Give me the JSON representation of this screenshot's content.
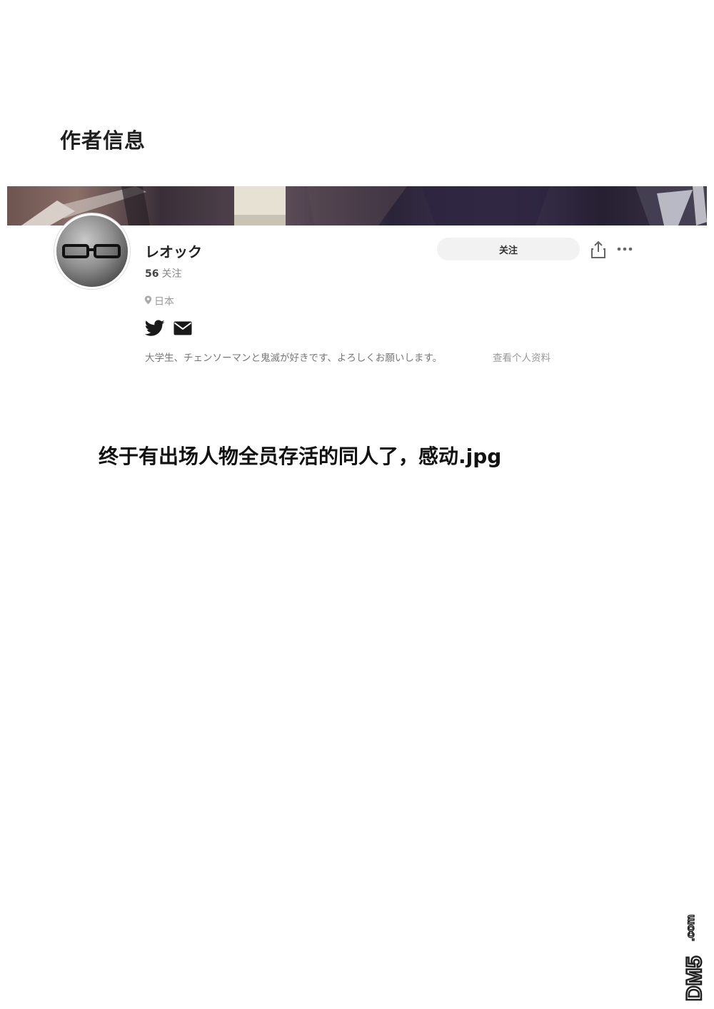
{
  "section_title": "作者信息",
  "profile": {
    "name": "レオック",
    "following_count": "56",
    "following_label": "关注",
    "location": "日本",
    "bio": "大学生、チェンソーマンと鬼滅が好きです、よろしくお願いします。",
    "view_profile_label": "查看个人资料",
    "follow_button_label": "关注",
    "social_icons": [
      "twitter-icon",
      "mail-icon"
    ]
  },
  "caption": "终于有出场人物全员存活的同人了，感动.jpg",
  "watermark": {
    "text": "DM5",
    "suffix": ".com"
  }
}
